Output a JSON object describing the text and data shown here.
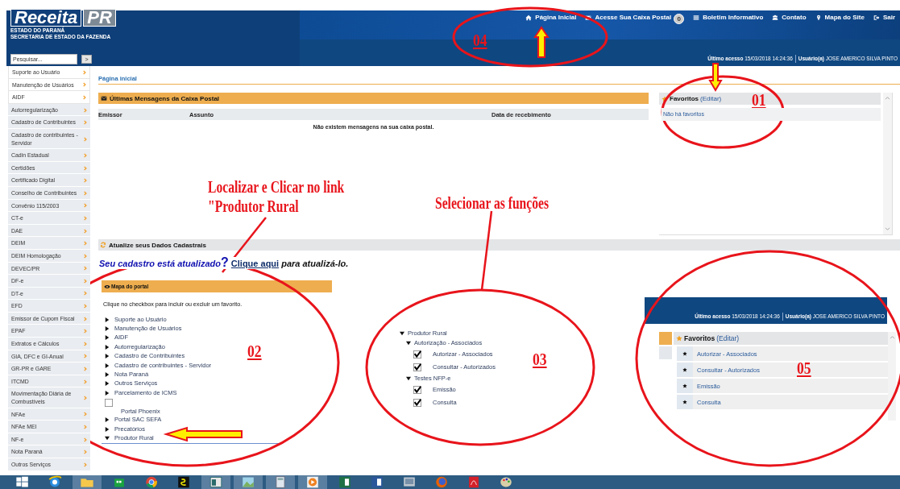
{
  "header": {
    "logo": {
      "text": "Receita",
      "tag": "PR"
    },
    "subtitle": [
      "ESTADO DO PARANÁ",
      "SECRETARIA DE ESTADO DA FAZENDA"
    ],
    "search": {
      "placeholder": "Pesquisar..."
    },
    "search_button": ">",
    "nav": [
      {
        "kind": "home",
        "label": "Página Inicial"
      },
      {
        "kind": "mail",
        "label": "Acesse Sua Caixa Postal",
        "badge": "0"
      },
      {
        "kind": "list",
        "label": "Boletim Informativo"
      },
      {
        "kind": "users",
        "label": "Contato"
      },
      {
        "kind": "pin",
        "label": "Mapa do Site"
      },
      {
        "kind": "exit",
        "label": "Sair"
      }
    ],
    "session": {
      "last_access_label": "Último acesso",
      "last_access": "15/03/2018 14:24:36",
      "user_label": "Usuário(a)",
      "user": "JOSE AMERICO SILVA PINTO"
    }
  },
  "sidebar": {
    "items": [
      "Suporte ao Usuário",
      "Manutenção de Usuários",
      "AIDF",
      "Autorregularização",
      "Cadastro de Contribuintes",
      "Cadastro de contribuintes - Servidor",
      "Cadin Estadual",
      "Certidões",
      "Certificado Digital",
      "Conselho de Contribuintes",
      "Convênio 115/2003",
      "CT-e",
      "DAE",
      "DEIM",
      "DEIM Homologação",
      "DEVEC/PR",
      "DF-e",
      "DT-e",
      "EFD",
      "Emissor de Cupom Fiscal",
      "EPAF",
      "Extratos e Cálculos",
      "GIA, DFC e GI-Anual",
      "GR-PR e GARE",
      "ITCMD",
      "Movimentação Diária de Combustíveis",
      "NFAe",
      "NFAe MEI",
      "NF-e",
      "Nota Paraná",
      "Outros Serviços"
    ]
  },
  "breadcrumb": "Página inicial",
  "messages": {
    "title": "Últimas Mensagens da Caixa Postal",
    "columns": [
      "Emissor",
      "Assunto",
      "Data de recebimento"
    ],
    "empty": "Não existem mensagens na sua caixa postal."
  },
  "favorites": {
    "title": "Favoritos",
    "edit": "(Editar)",
    "empty": "Não há favoritos"
  },
  "update": {
    "title": "Atualize seus Dados Cadastrais",
    "question": "Seu cadastro está atualizado",
    "mark": "?",
    "link": "Clique aqui",
    "rest": "para atualizá-lo."
  },
  "portal_map": {
    "title": "Mapa do portal",
    "hint": "Clique no checkbox para incluir ou excluir um favorito.",
    "items": [
      {
        "kind": "folder",
        "label": "Suporte ao Usuário",
        "expanded": false
      },
      {
        "kind": "folder",
        "label": "Manutenção de Usuários",
        "expanded": false
      },
      {
        "kind": "folder",
        "label": "AIDF",
        "expanded": false
      },
      {
        "kind": "folder",
        "label": "Autorregularização",
        "expanded": false
      },
      {
        "kind": "folder",
        "label": "Cadastro de Contribuintes",
        "expanded": false
      },
      {
        "kind": "folder",
        "label": "Cadastro de contribuintes - Servidor",
        "expanded": false
      },
      {
        "kind": "folder",
        "label": "Nota Paraná",
        "expanded": false
      },
      {
        "kind": "folder",
        "label": "Outros Serviços",
        "expanded": false
      },
      {
        "kind": "folder",
        "label": "Parcelamento de ICMS",
        "expanded": false
      },
      {
        "kind": "checkbox",
        "label": "Portal Phoenix",
        "checked": false
      },
      {
        "kind": "folder",
        "label": "Portal SAC SEFA",
        "expanded": false
      },
      {
        "kind": "folder",
        "label": "Precatórios",
        "expanded": false
      },
      {
        "kind": "folder",
        "label": "Produtor Rural",
        "expanded": true
      }
    ]
  },
  "inset_tree": {
    "items": [
      {
        "kind": "folder",
        "label": "Produtor Rural",
        "expanded": true,
        "children": [
          {
            "kind": "folder",
            "label": "Autorização - Associados",
            "expanded": true,
            "children": [
              {
                "kind": "checkbox",
                "label": "Autorizar - Associados",
                "checked": true
              },
              {
                "kind": "checkbox",
                "label": "Consultar - Autorizados",
                "checked": true
              }
            ]
          },
          {
            "kind": "folder",
            "label": "Testes NFP-e",
            "expanded": true,
            "children": [
              {
                "kind": "checkbox",
                "label": "Emissão",
                "checked": true
              },
              {
                "kind": "checkbox",
                "label": "Consulta",
                "checked": true
              }
            ]
          }
        ]
      }
    ]
  },
  "inset_favorites": {
    "session": {
      "last_access_label": "Último acesso",
      "last_access": "15/03/2018 14:24:36",
      "user_label": "Usuário(a)",
      "user": "JOSE AMERICO SILVA PINTO"
    },
    "title": "Favoritos",
    "edit": "(Editar)",
    "items": [
      "Autorizar - Associados",
      "Consultar - Autorizados",
      "Emissão",
      "Consulta"
    ]
  },
  "callouts": [
    {
      "number": "04"
    },
    {
      "number": "01"
    },
    {
      "number": "02"
    },
    {
      "number": "03"
    },
    {
      "number": "05"
    }
  ],
  "instructions": [
    {
      "text": "Localizar e Clicar no link\n\"Produtor Rural"
    },
    {
      "text": "Selecionar as funções"
    }
  ]
}
